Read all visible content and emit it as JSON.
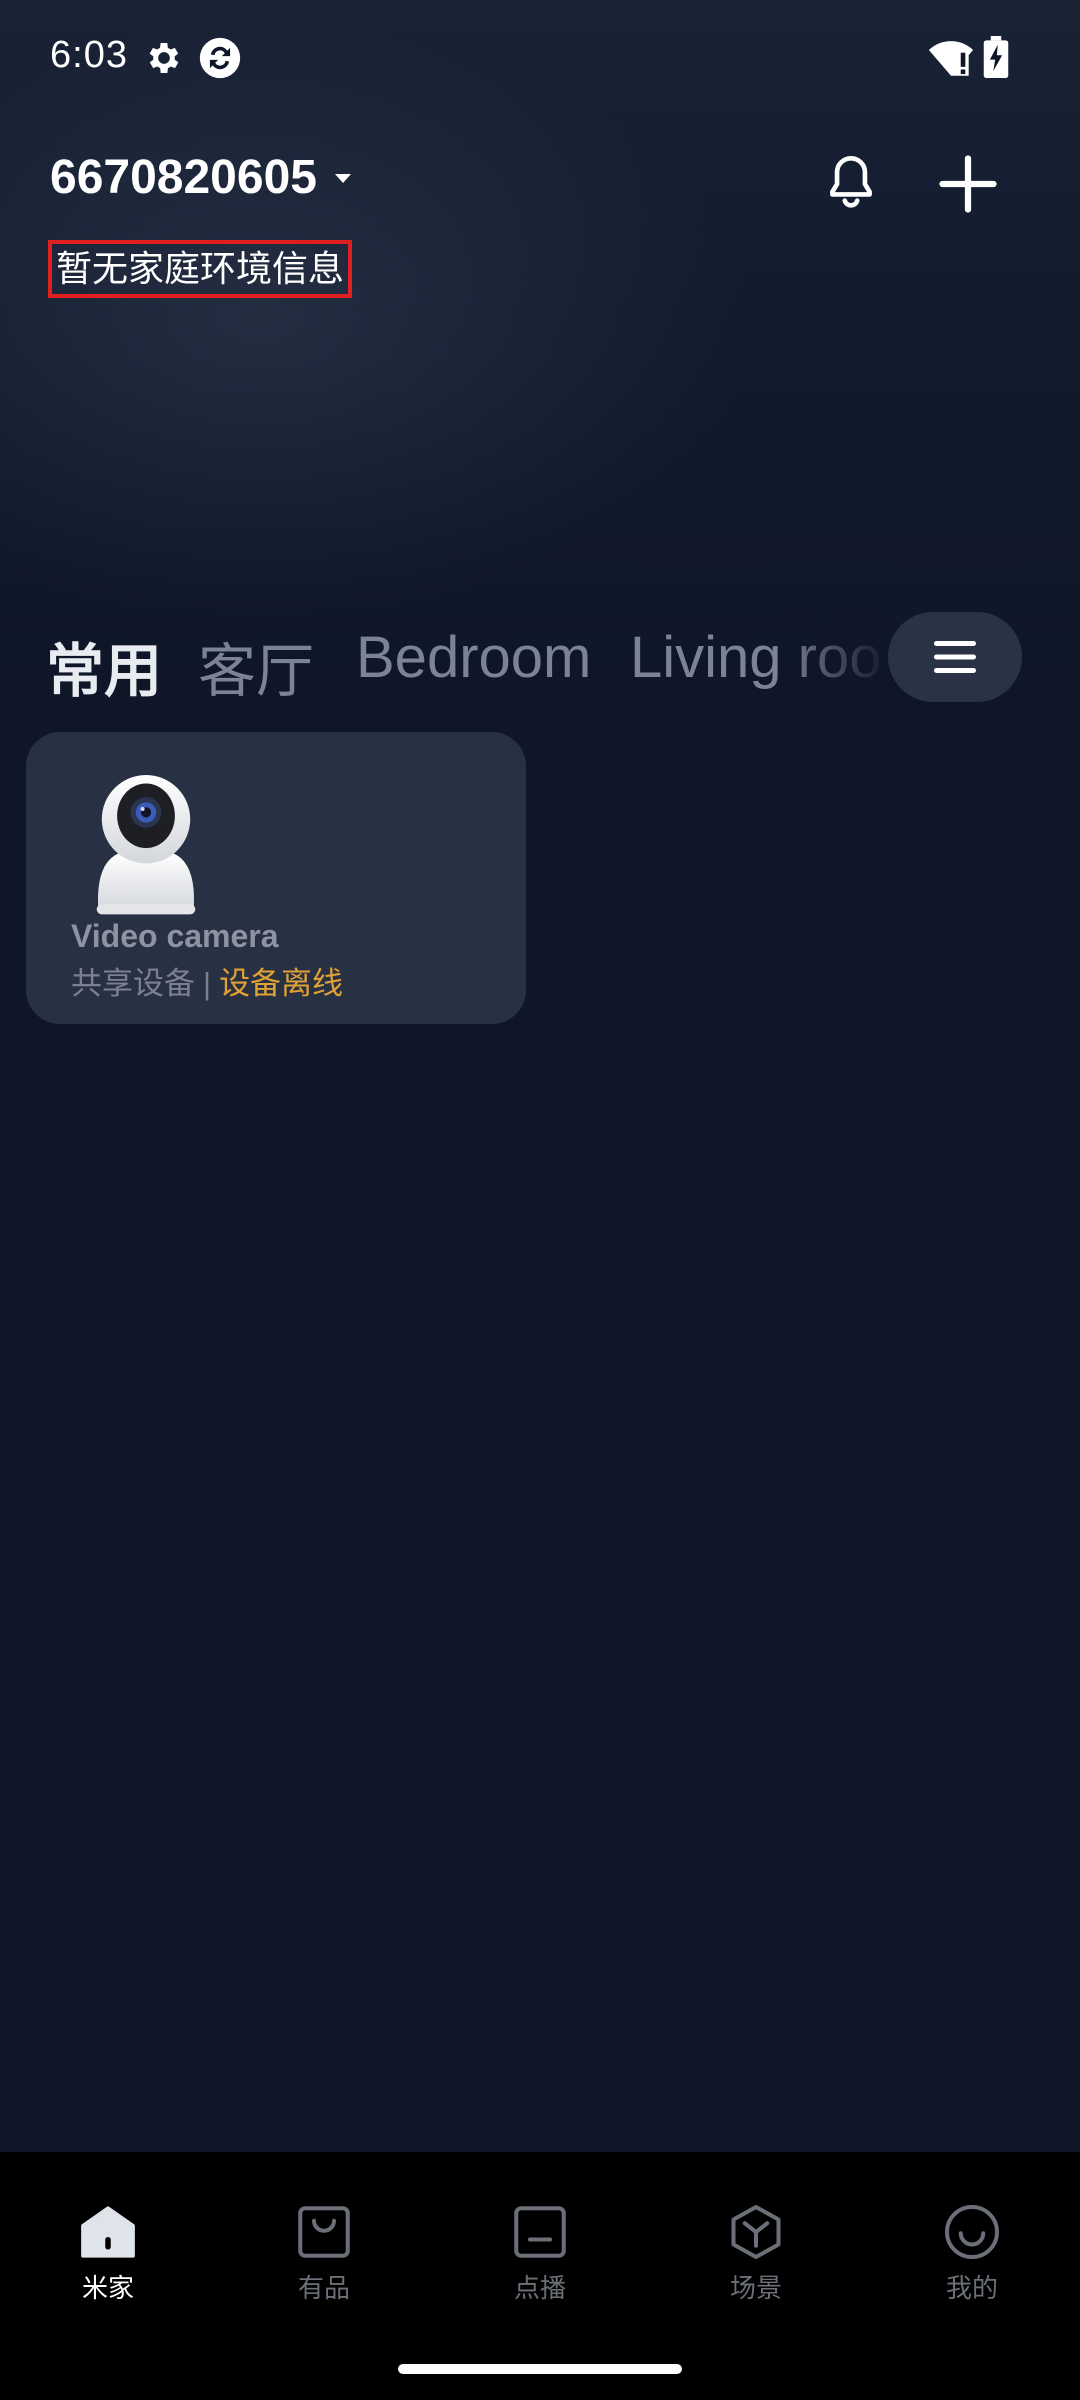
{
  "status_bar": {
    "time": "6:03",
    "icons": [
      "gear-icon",
      "sync-icon",
      "wifi-alert-icon",
      "battery-charging-icon"
    ]
  },
  "header": {
    "home_name": "6670820605",
    "env_info": "暂无家庭环境信息",
    "icons": [
      "dropdown-arrow-icon",
      "bell-icon",
      "plus-icon"
    ]
  },
  "tabs": [
    {
      "label": "常用",
      "active": true
    },
    {
      "label": "客厅",
      "active": false
    },
    {
      "label": "Bedroom",
      "active": false
    },
    {
      "label": "Living room",
      "active": false
    }
  ],
  "tab_menu_icon": "menu-icon",
  "devices": [
    {
      "name": "Video camera",
      "shared_label": "共享设备",
      "separator": "|",
      "status": "设备离线",
      "status_color": "#e0a234",
      "icon": "camera-icon"
    }
  ],
  "bottom_nav": [
    {
      "label": "米家",
      "icon": "home-icon",
      "active": true
    },
    {
      "label": "有品",
      "icon": "bag-icon",
      "active": false
    },
    {
      "label": "点播",
      "icon": "tv-icon",
      "active": false
    },
    {
      "label": "场景",
      "icon": "cube-icon",
      "active": false
    },
    {
      "label": "我的",
      "icon": "smile-icon",
      "active": false
    }
  ],
  "colors": {
    "background": "#0e1628",
    "card": "#283043",
    "accent_offline": "#e0a234",
    "highlight_border": "#e02020"
  }
}
